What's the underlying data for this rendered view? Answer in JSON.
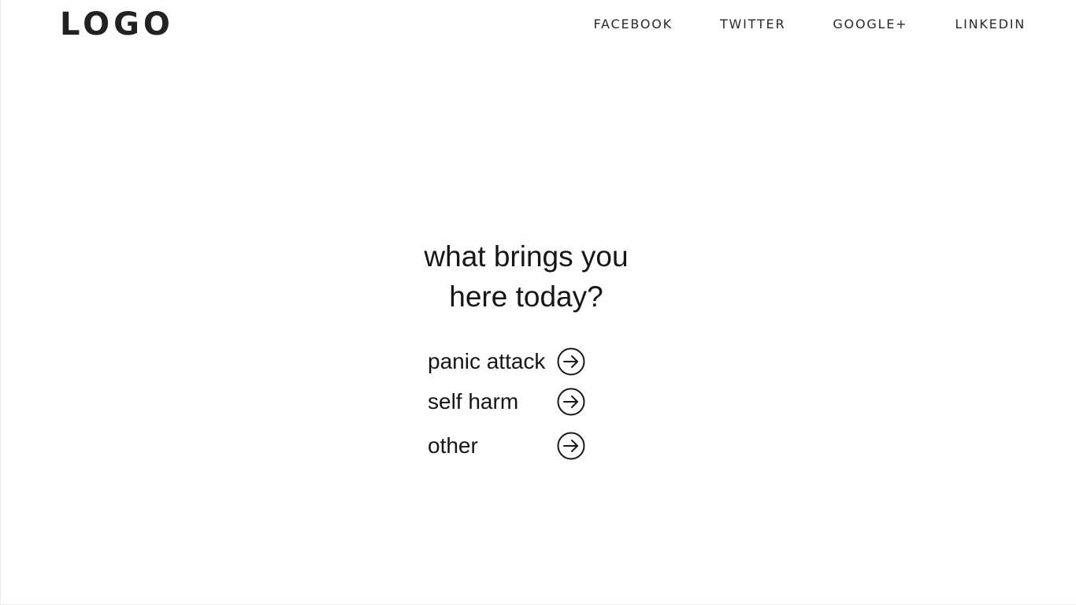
{
  "header": {
    "logo": "LOGO",
    "nav": [
      {
        "label": "FACEBOOK"
      },
      {
        "label": "TWITTER"
      },
      {
        "label": "GOOGLE+"
      },
      {
        "label": "LINKEDIN"
      }
    ]
  },
  "main": {
    "heading_line1": "what brings you",
    "heading_line2": "here today?",
    "options": [
      {
        "label": "panic attack",
        "icon": "arrow-right-circle-icon"
      },
      {
        "label": "self harm",
        "icon": "arrow-right-circle-icon"
      },
      {
        "label": "other",
        "icon": "arrow-right-circle-icon"
      }
    ]
  },
  "colors": {
    "background": "#ffffff",
    "text": "#161616"
  }
}
